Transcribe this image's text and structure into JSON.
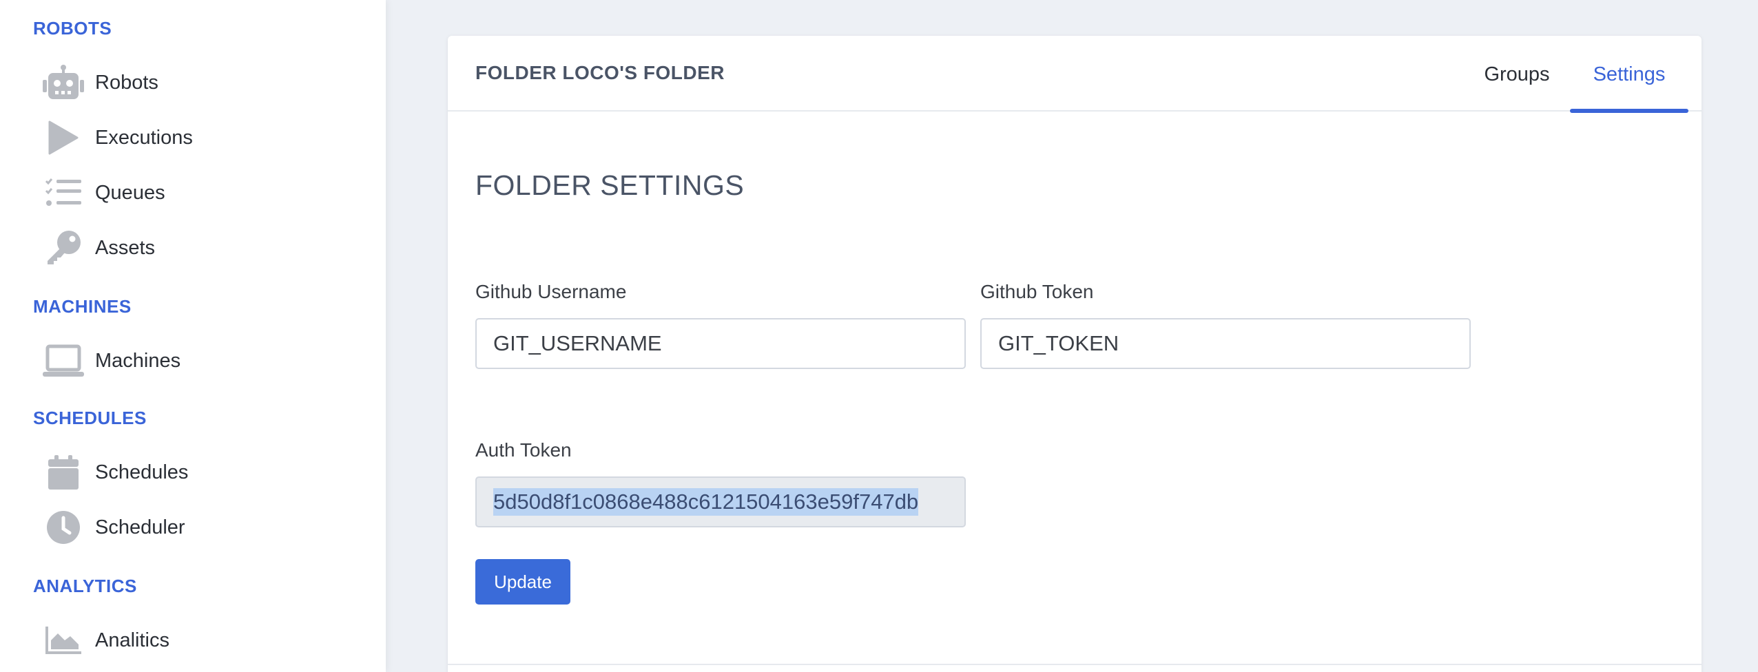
{
  "sidebar": {
    "sections": [
      {
        "title": "ROBOTS",
        "items": [
          {
            "label": "Robots",
            "icon": "robot-icon"
          },
          {
            "label": "Executions",
            "icon": "play-icon"
          },
          {
            "label": "Queues",
            "icon": "list-check-icon"
          },
          {
            "label": "Assets",
            "icon": "key-icon"
          }
        ]
      },
      {
        "title": "MACHINES",
        "items": [
          {
            "label": "Machines",
            "icon": "laptop-icon"
          }
        ]
      },
      {
        "title": "SCHEDULES",
        "items": [
          {
            "label": "Schedules",
            "icon": "calendar-icon"
          },
          {
            "label": "Scheduler",
            "icon": "clock-icon"
          }
        ]
      },
      {
        "title": "ANALYTICS",
        "items": [
          {
            "label": "Analitics",
            "icon": "area-chart-icon"
          }
        ]
      }
    ],
    "accent_color": "#3a64d8",
    "icon_color": "#b9bcc2"
  },
  "card": {
    "title": "FOLDER LOCO'S FOLDER",
    "tabs": [
      {
        "label": "Groups",
        "active": false
      },
      {
        "label": "Settings",
        "active": true
      }
    ],
    "heading": "FOLDER SETTINGS",
    "fields": {
      "github_username": {
        "label": "Github Username",
        "value": "GIT_USERNAME"
      },
      "github_token": {
        "label": "Github Token",
        "value": "GIT_TOKEN"
      },
      "auth_token": {
        "label": "Auth Token",
        "value": "5d50d8f1c0868e488c6121504163e59f747db"
      }
    },
    "update_label": "Update"
  }
}
